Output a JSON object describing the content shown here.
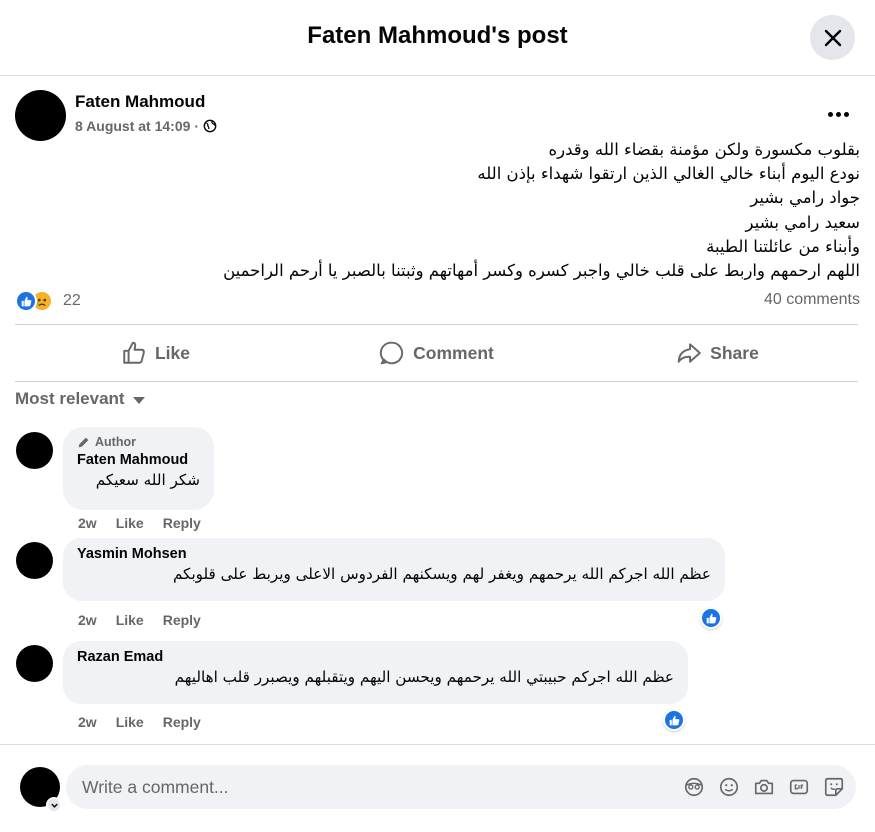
{
  "header": {
    "title": "Faten Mahmoud's post"
  },
  "post": {
    "author": "Faten Mahmoud",
    "timestamp": "8 August at 14:09",
    "separator": "·",
    "privacy_icon": "globe-icon",
    "lines": [
      "بقلوب مكسورة ولكن مؤمنة بقضاء الله وقدره",
      "نودع اليوم أبناء خالي الغالي الذين ارتقوا شهداء بإذن الله",
      "جواد رامي بشير",
      "سعيد رامي بشير",
      "وأبناء من عائلتنا الطيبة",
      "اللهم ارحمهم واربط على قلب خالي واجبر كسره وكسر أمهاتهم وثبتنا بالصبر يا أرحم الراحمين"
    ],
    "reaction_count": "22",
    "comments_count": "40 comments"
  },
  "actions": {
    "like": "Like",
    "comment": "Comment",
    "share": "Share"
  },
  "sort_label": "Most relevant",
  "comments": [
    {
      "author_badge": "Author",
      "name": "Faten Mahmoud",
      "text": "شكر الله سعيكم",
      "time": "2w",
      "like": "Like",
      "reply": "Reply"
    },
    {
      "name": "Yasmin Mohsen",
      "text": "عظم الله اجركم الله يرحمهم ويغفر لهم ويسكنهم الفردوس الاعلى ويربط على قلوبكم",
      "time": "2w",
      "like": "Like",
      "reply": "Reply"
    },
    {
      "name": "Razan Emad",
      "text": "عظم الله اجركم حبيبتي الله يرحمهم ويحسن اليهم ويتقبلهم ويصبرر قلب اهاليهم",
      "time": "2w",
      "like": "Like",
      "reply": "Reply"
    }
  ],
  "composer": {
    "placeholder": "Write a comment..."
  },
  "colors": {
    "accent": "#1b74e4",
    "secondary_text": "#65676b",
    "bubble": "#f0f2f5"
  }
}
